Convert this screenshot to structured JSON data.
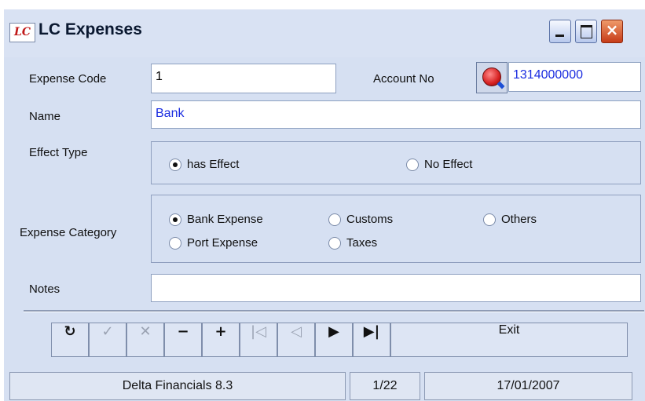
{
  "window": {
    "title": "LC Expenses",
    "icon_text": "LC",
    "buttons": {
      "minimize": "minimize",
      "maximize": "maximize",
      "close": "×"
    }
  },
  "form": {
    "expense_code": {
      "label": "Expense Code",
      "value": "1"
    },
    "account_no": {
      "label": "Account No",
      "value": "1314000000",
      "lookup_icon": "magnifier-icon"
    },
    "name": {
      "label": "Name",
      "value": "Bank"
    },
    "effect_type": {
      "label": "Effect Type",
      "options": [
        {
          "label": "has Effect",
          "checked": true
        },
        {
          "label": "No Effect",
          "checked": false
        }
      ]
    },
    "expense_category": {
      "label": "Expense Category",
      "options": [
        {
          "label": "Bank Expense",
          "checked": true
        },
        {
          "label": "Customs",
          "checked": false
        },
        {
          "label": "Others",
          "checked": false
        },
        {
          "label": "Port Expense",
          "checked": false
        },
        {
          "label": "Taxes",
          "checked": false
        }
      ]
    },
    "notes": {
      "label": "Notes",
      "value": ""
    }
  },
  "navigator": {
    "refresh": "↻",
    "post": "✓",
    "cancel": "✕",
    "delete": "−",
    "insert": "+",
    "first": "|◁",
    "prior": "◁",
    "next": "▶",
    "last": "▶|",
    "exit": "Exit"
  },
  "status": {
    "app": "Delta Financials 8.3",
    "record": "1/22",
    "date": "17/01/2007"
  },
  "colors": {
    "client_bg": "#d6e0f2",
    "titlebar_bg": "#d9e2f3",
    "field_text_blue": "#1a2ce0",
    "close_button": "#c63b18"
  }
}
